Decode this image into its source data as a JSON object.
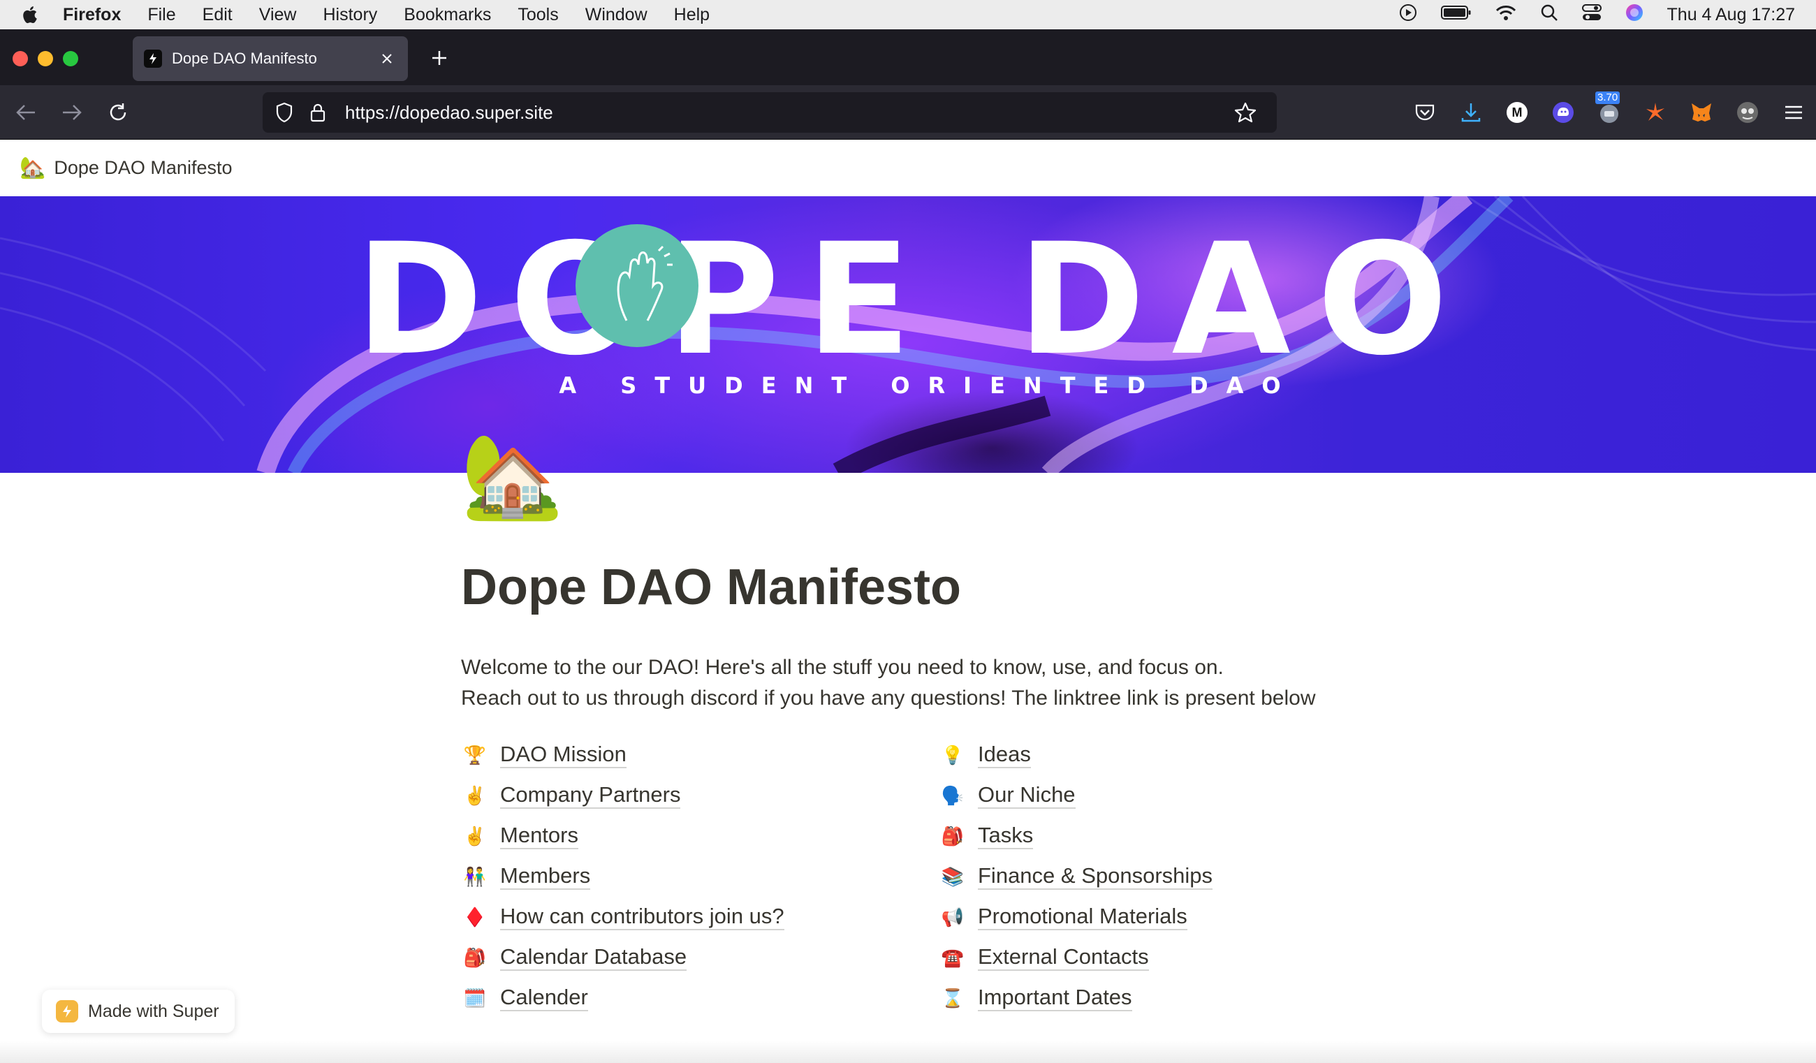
{
  "menubar": {
    "app_name": "Firefox",
    "items": [
      "File",
      "Edit",
      "View",
      "History",
      "Bookmarks",
      "Tools",
      "Window",
      "Help"
    ],
    "clock": "Thu 4 Aug  17:27"
  },
  "browser": {
    "tab_title": "Dope DAO Manifesto",
    "url": "https://dopedao.super.site",
    "extension_badge": "3.70"
  },
  "page": {
    "header_emoji": "🏡",
    "header_title": "Dope DAO Manifesto",
    "banner_title": "DOPE DAO",
    "banner_subtitle": "A STUDENT ORIENTED DAO",
    "page_icon": "🏡",
    "title": "Dope DAO Manifesto",
    "intro_line1": "Welcome to the our DAO! Here's all the stuff you need to know, use, and focus on.",
    "intro_line2": "Reach out to us through discord if you have any questions! The linktree link is present below",
    "links_left": [
      {
        "emoji": "🏆",
        "label": "DAO Mission"
      },
      {
        "emoji": "✌️",
        "label": "Company Partners"
      },
      {
        "emoji": "✌️",
        "label": "Mentors"
      },
      {
        "emoji": "👫",
        "label": "Members"
      },
      {
        "emoji": "♦️",
        "label": "How can contributors join us?"
      },
      {
        "emoji": "🎒",
        "label": "Calendar Database"
      },
      {
        "emoji": "🗓️",
        "label": "Calender"
      }
    ],
    "links_right": [
      {
        "emoji": "💡",
        "label": "Ideas"
      },
      {
        "emoji": "🗣️",
        "label": "Our Niche"
      },
      {
        "emoji": "🎒",
        "label": "Tasks"
      },
      {
        "emoji": "📚",
        "label": "Finance & Sponsorships"
      },
      {
        "emoji": "📢",
        "label": "Promotional Materials"
      },
      {
        "emoji": "☎️",
        "label": "External Contacts"
      },
      {
        "emoji": "⌛",
        "label": "Important Dates"
      }
    ]
  },
  "badge": {
    "label": "Made with Super"
  },
  "colors": {
    "text": "#37352f",
    "banner_blue": "#3a21d6",
    "teal": "#5fbfae",
    "toolbar": "#2b2a33"
  }
}
